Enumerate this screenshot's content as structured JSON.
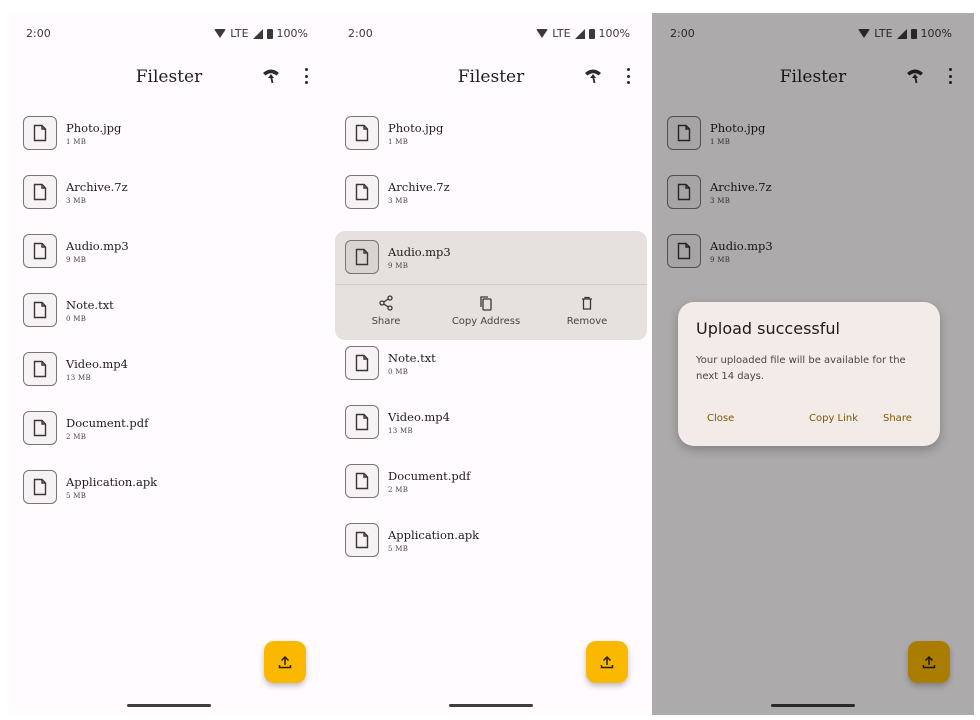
{
  "status": {
    "time": "2:00",
    "network": "LTE",
    "battery": "100%"
  },
  "app": {
    "title": "Filester"
  },
  "files": [
    {
      "name": "Photo.jpg",
      "size": "1 MB"
    },
    {
      "name": "Archive.7z",
      "size": "3 MB"
    },
    {
      "name": "Audio.mp3",
      "size": "9 MB"
    },
    {
      "name": "Note.txt",
      "size": "0 MB"
    },
    {
      "name": "Video.mp4",
      "size": "13 MB"
    },
    {
      "name": "Document.pdf",
      "size": "2 MB"
    },
    {
      "name": "Application.apk",
      "size": "5 MB"
    }
  ],
  "actions": {
    "share": "Share",
    "copy": "Copy Address",
    "remove": "Remove"
  },
  "dialog": {
    "title": "Upload successful",
    "body": "Your uploaded file will be available for the next 14 days.",
    "close": "Close",
    "copy_link": "Copy Link",
    "share": "Share"
  },
  "icons": {
    "file": "file-icon",
    "upload": "upload-icon",
    "network": "network-icon",
    "more": "more-vert-icon"
  },
  "colors": {
    "accent": "#fbb800",
    "surface": "#fffbfe",
    "selected": "#e6e1de",
    "dialog": "#f2ebe7",
    "dialog_button": "#7c5800"
  }
}
